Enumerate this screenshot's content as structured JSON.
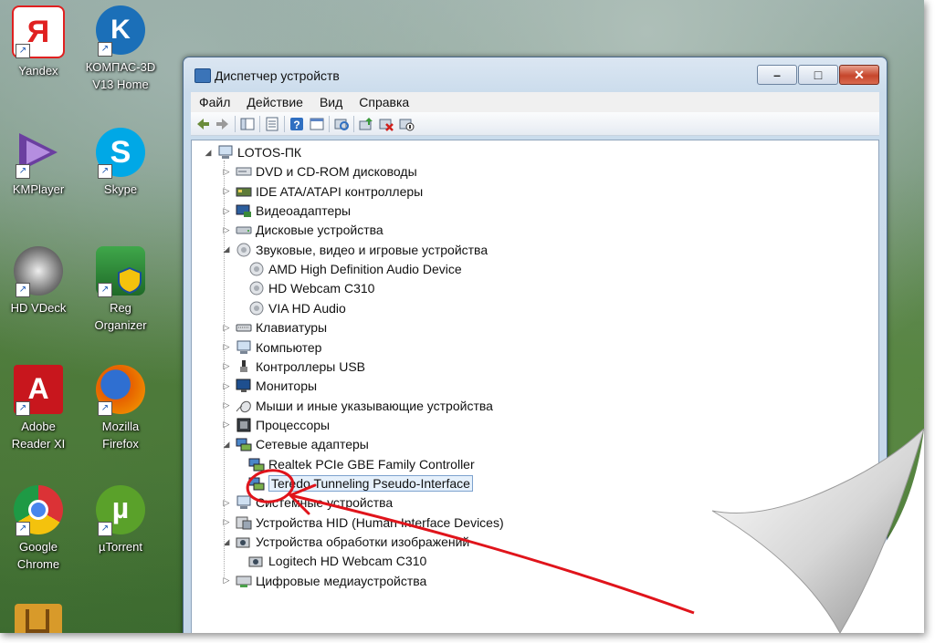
{
  "desktop": {
    "icons": [
      {
        "label": "Yandex",
        "icon": "yandex-icon",
        "color": "#e02020"
      },
      {
        "label": "КОМПАС-3D V13 Home",
        "icon": "kompas-icon",
        "color": "#1b6fb8"
      },
      {
        "label": "KMPlayer",
        "icon": "kmplayer-icon",
        "color": "#6b3fa0"
      },
      {
        "label": "Skype",
        "icon": "skype-icon",
        "color": "#00a8e6"
      },
      {
        "label": "HD VDeck",
        "icon": "vdeck-icon",
        "color": "#9a9a9a"
      },
      {
        "label": "Reg Organizer",
        "icon": "reg-organizer-icon",
        "color": "#2f8a3a"
      },
      {
        "label": "Adobe Reader XI",
        "icon": "adobe-reader-icon",
        "color": "#c8161d"
      },
      {
        "label": "Mozilla Firefox",
        "icon": "firefox-icon",
        "color": "#e66000"
      },
      {
        "label": "Google Chrome",
        "icon": "chrome-icon",
        "color": "#1e9a45"
      },
      {
        "label": "µTorrent",
        "icon": "utorrent-icon",
        "color": "#5aa12a"
      }
    ]
  },
  "window": {
    "title": "Диспетчер устройств",
    "buttons": {
      "minimize": "–",
      "maximize": "□",
      "close": "✕"
    }
  },
  "menu": [
    "Файл",
    "Действие",
    "Вид",
    "Справка"
  ],
  "tree": {
    "root": "LOTOS-ПК",
    "items": [
      "DVD и CD-ROM дисководы",
      "IDE ATA/ATAPI контроллеры",
      "Видеоадаптеры",
      "Дисковые устройства",
      "Звуковые, видео и игровые устройства",
      "AMD High Definition Audio Device",
      "HD Webcam C310",
      "VIA HD Audio",
      "Клавиатуры",
      "Компьютер",
      "Контроллеры USB",
      "Мониторы",
      "Мыши и иные указывающие устройства",
      "Процессоры",
      "Сетевые адаптеры",
      "Realtek PCIe GBE Family Controller",
      "Teredo Tunneling Pseudo-Interface",
      "Системные устройства",
      "Устройства HID (Human Interface Devices)",
      "Устройства обработки изображений",
      "Logitech HD Webcam C310",
      "Цифровые медиаустройства"
    ]
  },
  "annotation_color": "#e0141b"
}
